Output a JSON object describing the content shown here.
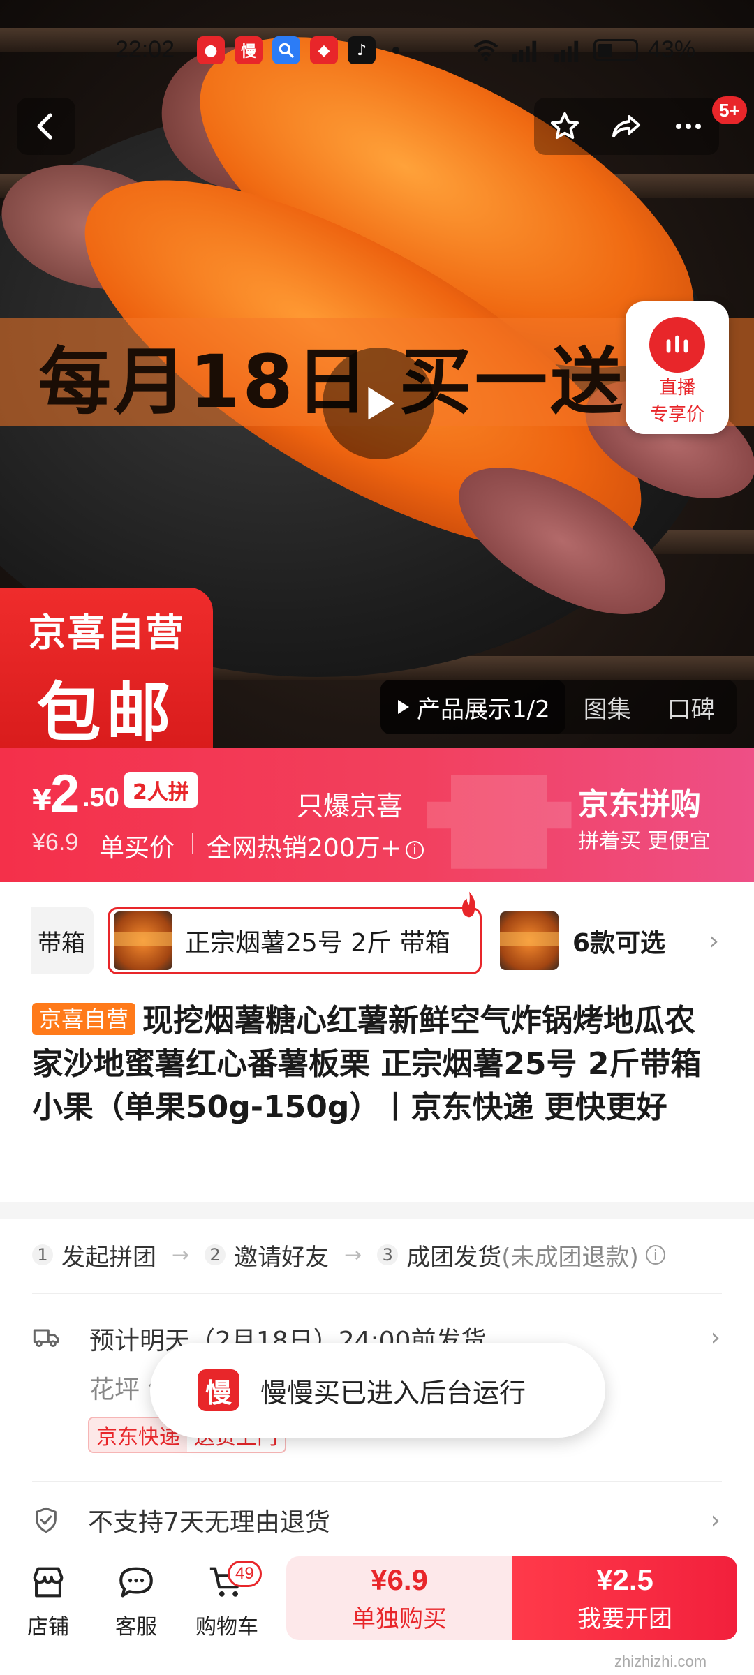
{
  "status_bar": {
    "time": "22:02",
    "battery": "43%",
    "notification_apps": [
      "app-1",
      "app-2",
      "app-3",
      "app-4",
      "app-5"
    ]
  },
  "header": {
    "message_badge": "5+"
  },
  "hero": {
    "banner_text": "每月18日 买一送",
    "live_badge_line1": "直播",
    "live_badge_line2": "专享价",
    "jingxi_badge_line1": "京喜自营",
    "jingxi_badge_line2": "包邮",
    "media_tabs": [
      "产品展示1/2",
      "图集",
      "口碑"
    ]
  },
  "price_bar": {
    "currency": "¥",
    "price_int": "2",
    "price_dec": ".50",
    "group_tag": "2人拼",
    "slogan": "只爆京喜",
    "original_price": "¥6.9",
    "single_price_label": "单买价",
    "hot_sales": "全网热销200万+",
    "brand": "京东拼购",
    "brand_sub": "拼着买 更便宜"
  },
  "variants": {
    "prev_label": "带箱",
    "selected_label": "正宗烟薯25号 2斤 带箱",
    "more_label": "6款可选"
  },
  "product": {
    "tag": "京喜自营",
    "title": "现挖烟薯糖心红薯新鲜空气炸锅烤地瓜农家沙地蜜薯红心番薯板栗 正宗烟薯25号 2斤带箱 小果（单果50g-150g）丨京东快递 更快更好"
  },
  "steps": {
    "s1_num": "1",
    "s1": "发起拼团",
    "s2_num": "2",
    "s2": "邀请好友",
    "s3_num": "3",
    "s3": "成团发货",
    "s3_note": "(未成团退款)"
  },
  "delivery": {
    "line1": "预计明天（2月18日）24:00前发货",
    "line2": "花坪  包邮",
    "chip_a": "京东快递",
    "chip_b": "送货上门"
  },
  "toast": {
    "icon_char": "慢",
    "text": "慢慢买已进入后台运行"
  },
  "policy": {
    "text": "不支持7天无理由退货"
  },
  "bottom_bar": {
    "store": "店铺",
    "service": "客服",
    "cart": "购物车",
    "cart_count": "49",
    "single_buy_price": "¥6.9",
    "single_buy_label": "单独购买",
    "group_buy_price": "¥2.5",
    "group_buy_label": "我要开团"
  },
  "watermark": "zhizhizhi.com",
  "colors": {
    "accent_red": "#e8262a",
    "price_gradient_start": "#f4304a",
    "price_gradient_end": "#ee4f86",
    "tag_orange": "#ff7a1a"
  }
}
